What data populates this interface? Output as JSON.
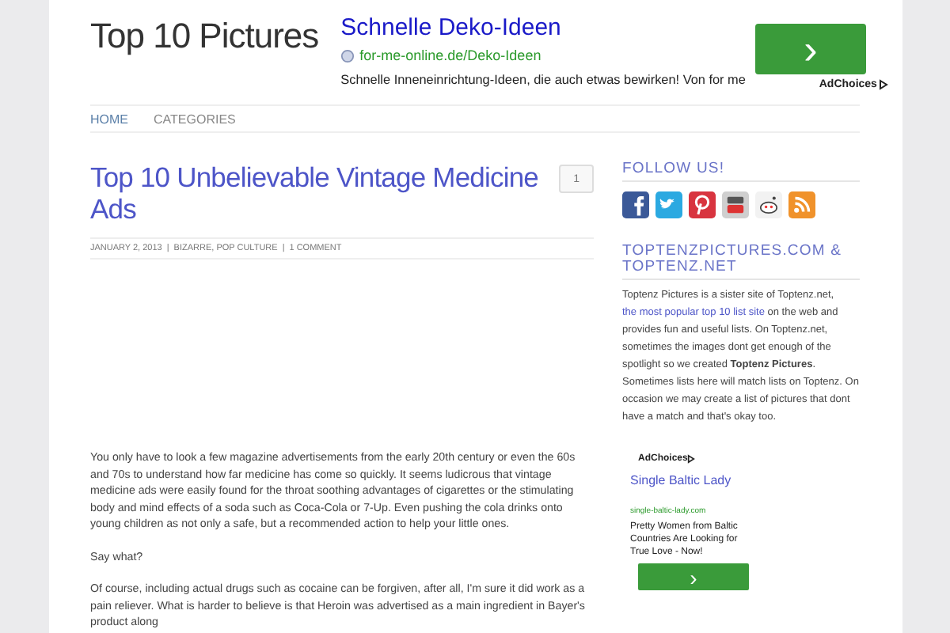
{
  "site_title": "Top 10 Pictures",
  "top_ad": {
    "headline": "Schnelle Deko-Ideen",
    "url": "for-me-online.de/Deko-Ideen",
    "description": "Schnelle Inneneinrichtung-Ideen, die auch etwas bewirken! Von for me",
    "button": "›",
    "adchoices": "AdChoices"
  },
  "nav": [
    {
      "label": "HOME",
      "selected": true
    },
    {
      "label": "CATEGORIES",
      "selected": false
    }
  ],
  "post": {
    "title": "Top 10 Unbelievable Vintage Medicine Ads",
    "comment_count": "1",
    "meta": [
      "JANUARY 2, 2013",
      "BIZARRE, POP CULTURE",
      "1 COMMENT"
    ],
    "meta_separator": "|",
    "paragraphs": [
      "You only have to look a few magazine advertisements from the early 20th century or even the 60s and 70s to understand how far medicine has come so quickly. It seems ludicrous that vintage medicine ads were easily found for the throat soothing advantages of cigarettes or the stimulating body and mind effects of a soda such as Coca-Cola or 7-Up. Even pushing the cola drinks onto young children as not only a safe, but a recommended action to help your little ones.",
      "Say what?",
      "Of course, including actual drugs such as cocaine can be forgiven, after all, I'm sure it did work as a pain reliever. What is harder to believe is that Heroin was advertised as a main ingredient in Bayer's product along"
    ]
  },
  "sidebar": {
    "follow_heading": "FOLLOW US!",
    "social": [
      {
        "kind": "facebook"
      },
      {
        "kind": "twitter"
      },
      {
        "kind": "pinterest"
      },
      {
        "kind": "youtube"
      },
      {
        "kind": "reddit"
      },
      {
        "kind": "rss"
      }
    ],
    "about_heading": "TOPTENZPICTURES.COM & TOPTENZ.NET",
    "about": {
      "before": "Toptenz Pictures is a sister site of Toptenz.net,",
      "link": "the most popular top 10 list site",
      "after": "on the web and provides fun and useful lists. On Toptenz.net, sometimes the images dont get enough of the spotlight so we created **Toptenz Pictures**. Sometimes lists here will match lists on Toptenz. On occasion we may create a list of pictures that dont have a match and that's okay too."
    },
    "ad": {
      "adchoices": "AdChoices",
      "headline": "Single Baltic Lady",
      "url": "single-baltic-lady.com",
      "description": "Pretty Women from Baltic Countries Are Looking for True Love - Now!",
      "button": "›"
    }
  }
}
